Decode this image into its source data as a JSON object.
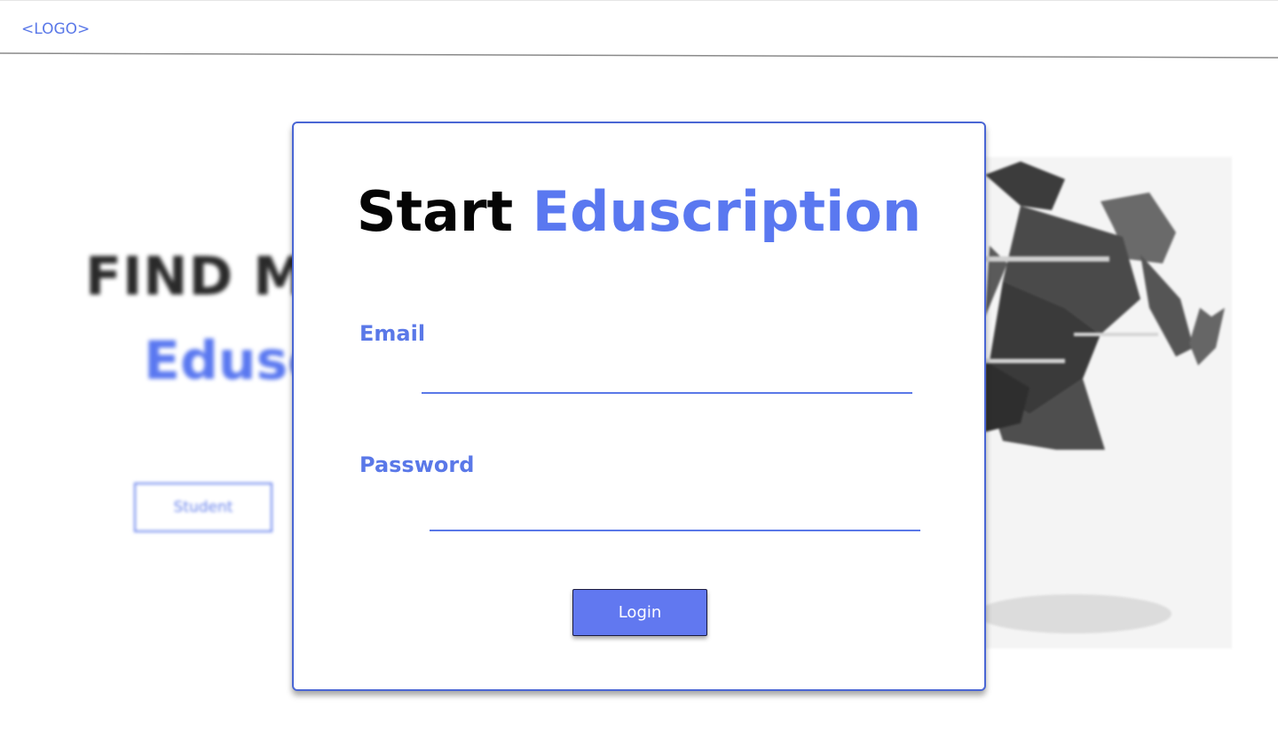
{
  "header": {
    "logo": "<LOGO>"
  },
  "hero": {
    "title": "FIND MY",
    "brand": "Eduscription",
    "student_button": "Student",
    "image_icon": "running-figure-illustration"
  },
  "modal": {
    "title_prefix": "Start",
    "title_brand": "Eduscription",
    "email_label": "Email",
    "email_value": "",
    "password_label": "Password",
    "password_value": "",
    "login_button": "Login"
  },
  "colors": {
    "accent": "#5a78f0",
    "button": "#6178f0",
    "modal_border": "#4a66d4",
    "title_dark": "#050505"
  }
}
